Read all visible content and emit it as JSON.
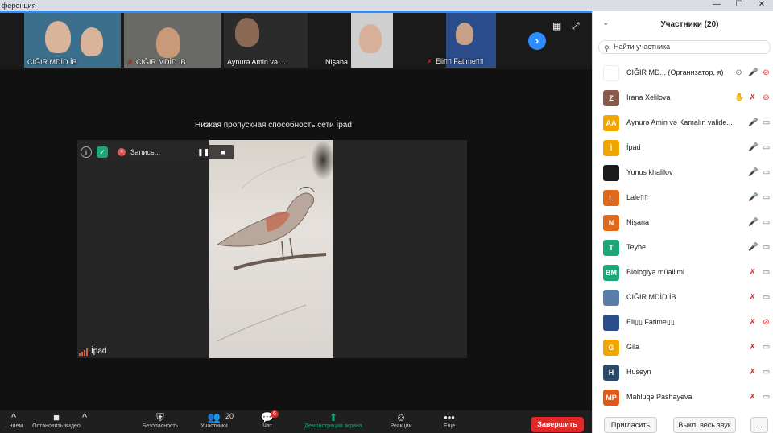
{
  "window": {
    "title": "ференция",
    "min": "—",
    "max": "☐",
    "close": "✕"
  },
  "thumbnails": [
    {
      "name": "CIĞIR MDİD İB",
      "muted": false,
      "bg": "#3b6f8c",
      "face": "#d9b49a"
    },
    {
      "name": "CIĞIR MDİD İB",
      "muted": true,
      "bg": "#6a6a66",
      "face": "#c89a7a"
    },
    {
      "name": "Aynurə Amin və ...",
      "muted": false,
      "bg": "#2b2b2b",
      "face": "#8a6a55"
    },
    {
      "name": "Nişana",
      "muted": false,
      "bg": "#cfcfcf",
      "face": "#d8b09a"
    },
    {
      "name": "Eli▯▯ Fatime▯▯",
      "muted": true,
      "bg": "#2b4d8c",
      "face": "#c9a088"
    }
  ],
  "main": {
    "low_bandwidth": "Низкая пропускная способность сети İpad",
    "video_name": "İpad",
    "recording_label": "Запись..."
  },
  "toolbar": {
    "items": [
      {
        "label": "...нием",
        "icon": "^"
      },
      {
        "label": "Остановить видео",
        "icon": "■"
      },
      {
        "label": "Безопасность",
        "icon": "⛨"
      },
      {
        "label": "Участники",
        "icon": "👥",
        "count": "20"
      },
      {
        "label": "Чат",
        "icon": "💬",
        "badge": "6"
      },
      {
        "label": "Демонстрация экрана",
        "icon": "⬆"
      },
      {
        "label": "Реакции",
        "icon": "☺"
      },
      {
        "label": "Еще",
        "icon": "•••"
      }
    ],
    "end_label": "Завершить"
  },
  "participants": {
    "title": "Участники (20)",
    "search_placeholder": "Найти участника",
    "list": [
      {
        "initials": "",
        "name": "CIĞIR MD...  (Организатор, я)",
        "color": "#ffffff",
        "mic": "on",
        "cam": "off",
        "extra": "share"
      },
      {
        "initials": "Z",
        "name": "Irana Xelilova",
        "color": "#8a5a4a",
        "mic": "off",
        "cam": "off",
        "extra": "hand"
      },
      {
        "initials": "AA",
        "name": "Aynurə Amin və  Kamalın valide...",
        "color": "#f0a500",
        "mic": "on",
        "cam": "on",
        "extra": ""
      },
      {
        "initials": "İ",
        "name": "İpad",
        "color": "#f0a500",
        "mic": "on",
        "cam": "on",
        "extra": ""
      },
      {
        "initials": "",
        "name": "Yunus khalilov",
        "color": "#1a1a1a",
        "mic": "on",
        "cam": "on",
        "extra": ""
      },
      {
        "initials": "L",
        "name": "Lale▯▯",
        "color": "#e06a1a",
        "mic": "on",
        "cam": "on",
        "extra": ""
      },
      {
        "initials": "N",
        "name": "Nişana",
        "color": "#e06a1a",
        "mic": "on",
        "cam": "on",
        "extra": ""
      },
      {
        "initials": "T",
        "name": "Teybe",
        "color": "#1aa876",
        "mic": "on",
        "cam": "on",
        "extra": ""
      },
      {
        "initials": "BM",
        "name": "Biologiya müəllimi",
        "color": "#1aa876",
        "mic": "off",
        "cam": "on",
        "extra": ""
      },
      {
        "initials": "",
        "name": "CIĞIR MDİD İB",
        "color": "#5a7ea8",
        "mic": "off",
        "cam": "on",
        "extra": ""
      },
      {
        "initials": "",
        "name": "Eli▯▯ Fatime▯▯",
        "color": "#2b4d8c",
        "mic": "off",
        "cam": "off",
        "extra": ""
      },
      {
        "initials": "G",
        "name": "Gila",
        "color": "#f0a500",
        "mic": "off",
        "cam": "on",
        "extra": ""
      },
      {
        "initials": "H",
        "name": "Huseyn",
        "color": "#2b4a6a",
        "mic": "off",
        "cam": "on",
        "extra": ""
      },
      {
        "initials": "MP",
        "name": "Mahluqe Pashayeva",
        "color": "#e05a1a",
        "mic": "off",
        "cam": "on",
        "extra": ""
      }
    ],
    "invite_label": "Пригласить",
    "mute_all_label": "Выкл. весь звук",
    "more_label": "..."
  },
  "colors": {
    "accent": "#2d8cff",
    "danger": "#e02828"
  }
}
